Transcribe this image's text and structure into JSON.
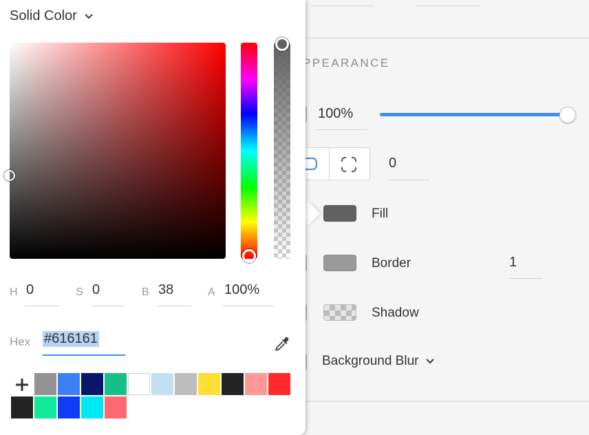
{
  "color_picker": {
    "fill_type": "Solid Color",
    "channels": [
      {
        "label": "H",
        "value": "0"
      },
      {
        "label": "S",
        "value": "0"
      },
      {
        "label": "B",
        "value": "38"
      },
      {
        "label": "A",
        "value": "100%"
      }
    ],
    "hex_label": "Hex",
    "hex_value": "#616161",
    "hue_color": "#ff0000",
    "current_color": "#616161",
    "palette": [
      "#939393",
      "#3d7ff4",
      "#09176b",
      "#16bf88",
      "#ffffff",
      "#c1e1f0",
      "#bdbdbd",
      "#fdde33",
      "#232323",
      "#ff9797",
      "#ff2a2a",
      "#232323",
      "#10e99a",
      "#0f3df5",
      "#00e8f6",
      "#ff6870"
    ]
  },
  "inspector": {
    "section_title": "PPEARANCE",
    "opacity": {
      "value": "100%",
      "level": 1.0
    },
    "corner_radius": "0",
    "fill_label": "Fill",
    "fill_color": "#616161",
    "border_label": "Border",
    "border_color": "#9a9a9a",
    "border_width": "1",
    "shadow_label": "Shadow",
    "background_blur_label": "Background Blur",
    "accent_color": "#3a8ef0"
  }
}
